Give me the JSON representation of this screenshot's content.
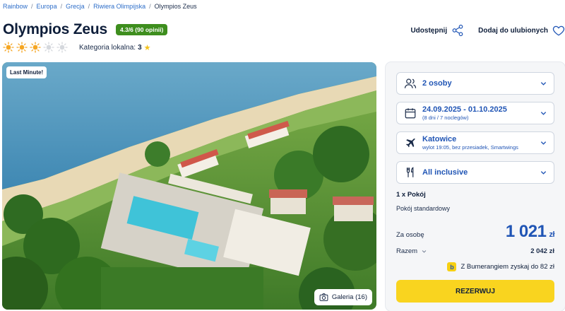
{
  "breadcrumb": {
    "items": [
      "Rainbow",
      "Europa",
      "Grecja",
      "Riwiera Olimpijska"
    ],
    "current": "Olympios Zeus",
    "separator": "/"
  },
  "hotel": {
    "name": "Olympios Zeus",
    "rating_badge": "4.3/6 (90 opinii)",
    "stars_filled": 3,
    "stars_total": 5,
    "local_category_label": "Kategoria lokalna:",
    "local_category_value": "3"
  },
  "actions": {
    "share_label": "Udostępnij",
    "favorite_label": "Dodaj do ulubionych"
  },
  "hero": {
    "badge": "Last Minute!",
    "gallery_label": "Galeria (16)"
  },
  "booking": {
    "persons": "2 osoby",
    "dates_main": "24.09.2025 - 01.10.2025",
    "dates_sub": "(8 dni / 7 noclegów)",
    "departure_main": "Katowice",
    "departure_sub": "wylot 19:05, bez przesiadek, Smartwings",
    "board": "All inclusive",
    "room_count": "1 x Pokój",
    "room_type": "Pokój standardowy",
    "per_person_label": "Za osobę",
    "per_person_value": "1 021",
    "currency": "zł",
    "total_label": "Razem",
    "total_value": "2 042 zł",
    "bumerang_text": "Z Bumerangiem zyskaj do 82 zł",
    "bumerang_icon": "b",
    "reserve_label": "REZERWUJ"
  },
  "colors": {
    "brand_blue": "#2055b5",
    "rating_green": "#3e8e1e",
    "reserve_yellow": "#f9d41f",
    "sun_active": "#f5a623",
    "sun_inactive": "#d5d8dd"
  }
}
